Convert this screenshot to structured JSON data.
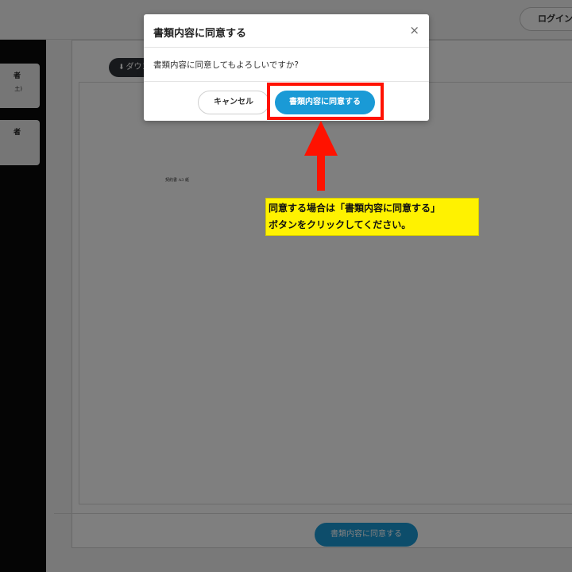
{
  "header": {
    "login_label": "ログイン"
  },
  "sidebar": {
    "cards": [
      {
        "line1": "者",
        "line2": "土)"
      },
      {
        "line1": "者",
        "line2": ""
      }
    ]
  },
  "document": {
    "download_label": "ダウンロード",
    "caption": "契約書 A3 紙",
    "footer_agree_label": "書類内容に同意する"
  },
  "modal": {
    "title": "書類内容に同意する",
    "close_glyph": "×",
    "message": "書類内容に同意してもよろしいですか?",
    "cancel_label": "キャンセル",
    "agree_label": "書類内容に同意する"
  },
  "annotation": {
    "line1": "同意する場合は「書類内容に同意する」",
    "line2": "ボタンをクリックしてください。",
    "arrow_color": "#ff1200",
    "highlight_color": "#ff1200",
    "callout_color": "#fff200"
  },
  "colors": {
    "accent": "#1a9ad6"
  }
}
